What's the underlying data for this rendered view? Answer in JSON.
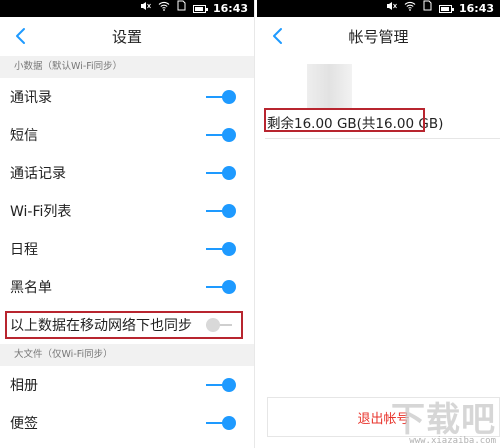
{
  "status_bar": {
    "time": "16:43"
  },
  "left": {
    "title": "设置",
    "section_small": "小数据（默认Wi-Fi同步）",
    "items": [
      {
        "label": "通讯录",
        "on": true
      },
      {
        "label": "短信",
        "on": true
      },
      {
        "label": "通话记录",
        "on": true
      },
      {
        "label": "Wi-Fi列表",
        "on": true
      },
      {
        "label": "日程",
        "on": true
      },
      {
        "label": "黑名单",
        "on": true
      }
    ],
    "mobile_sync": {
      "label": "以上数据在移动网络下也同步",
      "on": false
    },
    "section_large": "大文件（仅Wi-Fi同步）",
    "large_items": [
      {
        "label": "相册",
        "on": true
      },
      {
        "label": "便签",
        "on": true
      }
    ]
  },
  "right": {
    "title": "帐号管理",
    "storage": "剩余16.00 GB(共16.00 GB)",
    "logout_label": "退出帐号"
  },
  "watermark": {
    "main": "下载吧",
    "sub": "www.xiazaiba.com"
  },
  "colors": {
    "accent": "#1e9aff",
    "highlight": "#b8252f",
    "logout": "#e8342c"
  },
  "icons": [
    "mute-icon",
    "wifi-icon",
    "sim-icon",
    "battery-icon",
    "back-chevron-icon",
    "toggle-switch-icon"
  ]
}
